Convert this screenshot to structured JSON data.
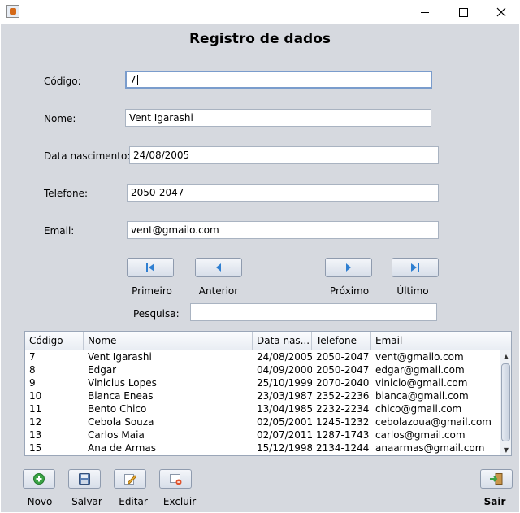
{
  "window": {
    "app_icon": "java-cup-icon",
    "controls": [
      "minimize-icon",
      "maximize-icon",
      "close-icon"
    ]
  },
  "form": {
    "title": "Registro de dados",
    "codigo": {
      "label": "Código:",
      "value": "7"
    },
    "nome": {
      "label": "Nome:",
      "value": "Vent Igarashi"
    },
    "data_nascimento": {
      "label": "Data nascimento:",
      "value": "24/08/2005"
    },
    "telefone": {
      "label": "Telefone:",
      "value": "2050-2047"
    },
    "email": {
      "label": "Email:",
      "value": "vent@gmailo.com"
    }
  },
  "navigation": {
    "first": {
      "label": "Primeiro",
      "icon": "skip-first-icon"
    },
    "previous": {
      "label": "Anterior",
      "icon": "arrow-left-icon"
    },
    "next": {
      "label": "Próximo",
      "icon": "arrow-right-icon"
    },
    "last": {
      "label": "Último",
      "icon": "skip-last-icon"
    }
  },
  "search": {
    "label": "Pesquisa:",
    "value": ""
  },
  "table": {
    "columns": [
      "Código",
      "Nome",
      "Data nas...",
      "Telefone",
      "Email"
    ],
    "rows": [
      [
        "7",
        "Vent Igarashi",
        "24/08/2005",
        "2050-2047",
        "vent@gmailo.com"
      ],
      [
        "8",
        "Edgar",
        "04/09/2000",
        "2050-2047",
        "edgar@gmail.com"
      ],
      [
        "9",
        "Vinicius Lopes",
        "25/10/1999",
        "2070-2040",
        "vinicio@gmail.com"
      ],
      [
        "10",
        "Bianca Eneas",
        "23/03/1987",
        "2352-2236",
        "bianca@gmail.com"
      ],
      [
        "11",
        "Bento Chico",
        "13/04/1985",
        "2232-2234",
        "chico@gmail.com"
      ],
      [
        "12",
        "Cebola Souza",
        "02/05/2001",
        "1245-1232",
        "cebolazoua@gmail.com"
      ],
      [
        "13",
        "Carlos Maia",
        "02/07/2011",
        "1287-1743",
        "carlos@gmail.com"
      ],
      [
        "15",
        "Ana de Armas",
        "15/12/1998",
        "2134-1244",
        "anaarmas@gmail.com"
      ]
    ]
  },
  "actions": {
    "novo": {
      "label": "Novo",
      "icon": "add-icon"
    },
    "salvar": {
      "label": "Salvar",
      "icon": "save-icon"
    },
    "editar": {
      "label": "Editar",
      "icon": "edit-icon"
    },
    "excluir": {
      "label": "Excluir",
      "icon": "delete-icon"
    },
    "sair": {
      "label": "Sair",
      "icon": "exit-door-icon"
    }
  },
  "colors": {
    "background": "#d6d9df",
    "accent_green": "#3aa346",
    "accent_blue": "#2f7fd1"
  }
}
